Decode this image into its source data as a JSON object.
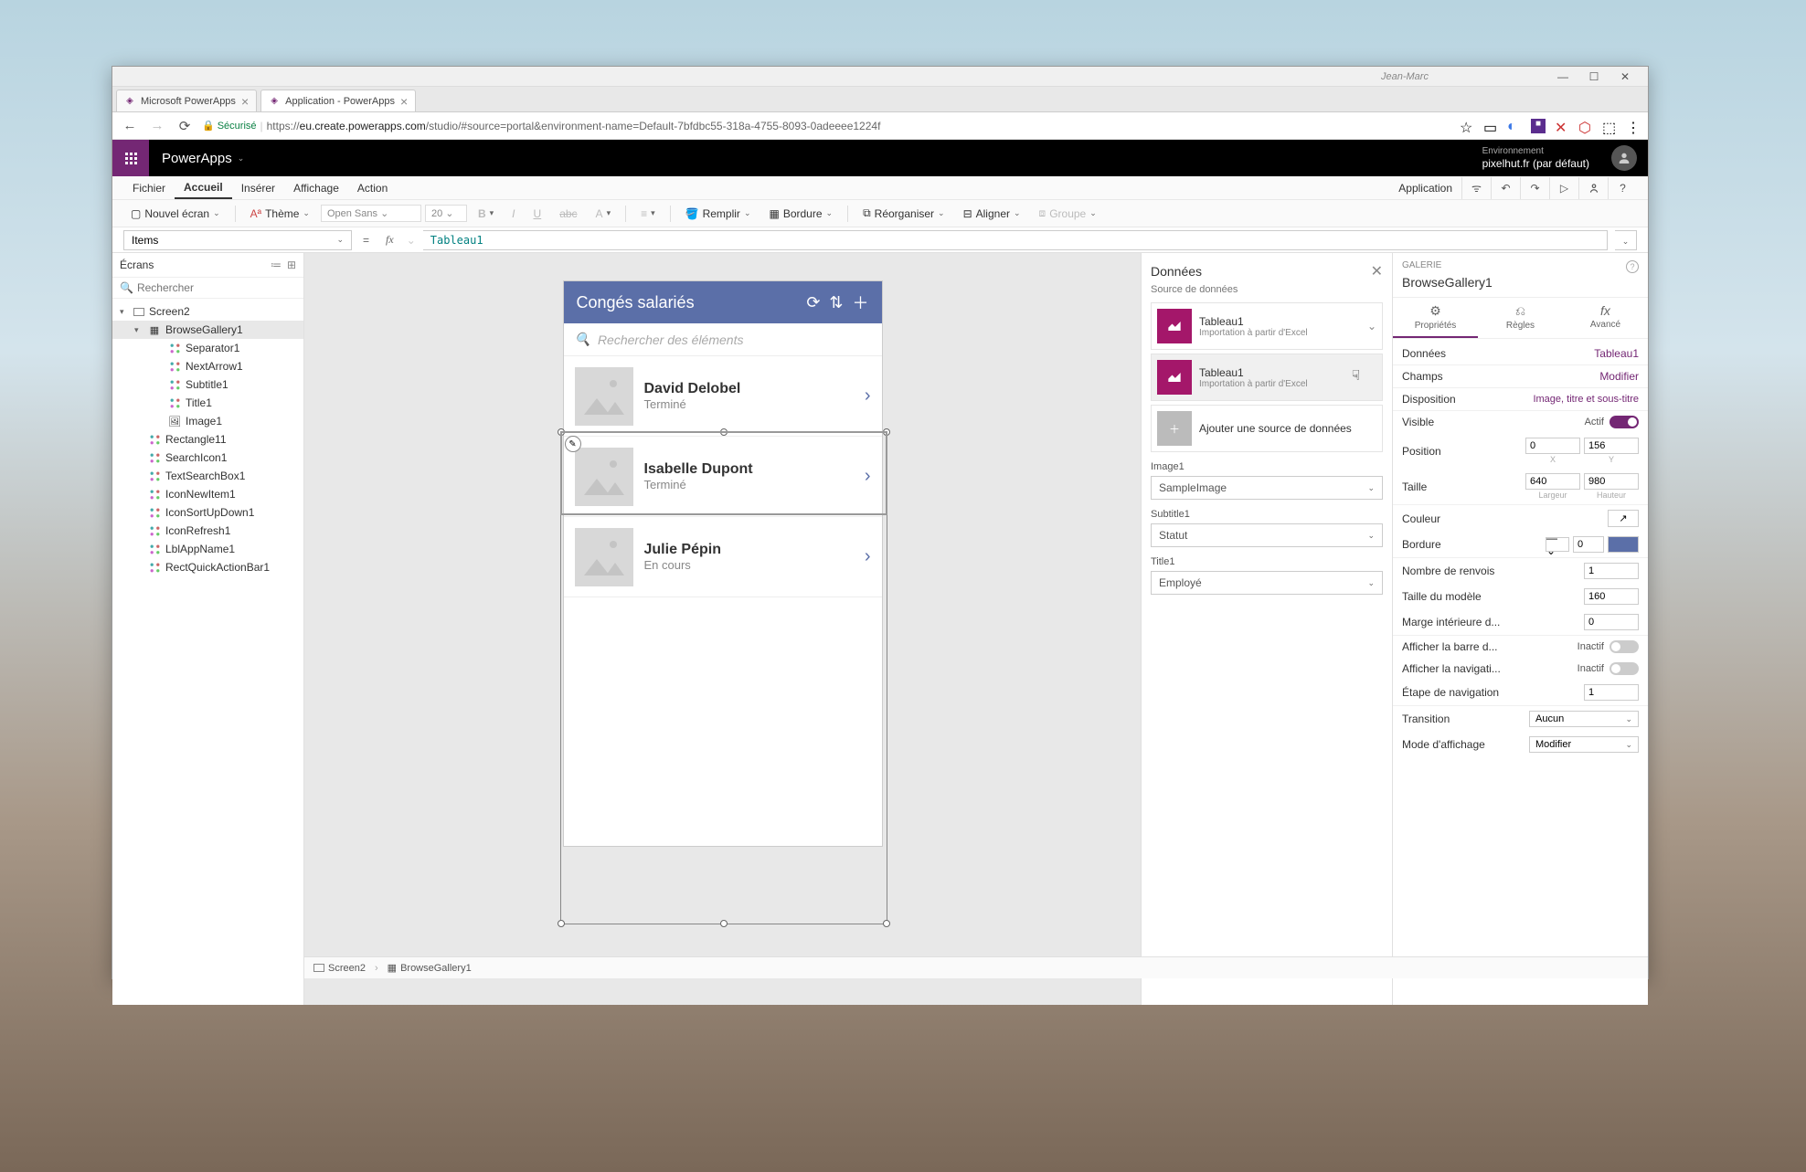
{
  "window": {
    "user": "Jean-Marc"
  },
  "tabs": [
    {
      "label": "Microsoft PowerApps"
    },
    {
      "label": "Application - PowerApps"
    }
  ],
  "address": {
    "secure": "Sécurisé",
    "url_prefix": "https://",
    "url_host": "eu.create.powerapps.com",
    "url_path": "/studio/#source=portal&environment-name=Default-7bfdbc55-318a-4755-8093-0adeeee1224f"
  },
  "app_header": {
    "name": "PowerApps",
    "env_label": "Environnement",
    "env_value": "pixelhut.fr (par défaut)"
  },
  "menu": {
    "items": [
      "Fichier",
      "Accueil",
      "Insérer",
      "Affichage",
      "Action"
    ],
    "application": "Application"
  },
  "toolbar": {
    "new_screen": "Nouvel écran",
    "theme": "Thème",
    "font": "Open Sans",
    "size": "20",
    "fill": "Remplir",
    "border": "Bordure",
    "reorganize": "Réorganiser",
    "align": "Aligner",
    "group": "Groupe"
  },
  "formula": {
    "property": "Items",
    "value": "Tableau1"
  },
  "tree": {
    "header": "Écrans",
    "search_ph": "Rechercher",
    "items": [
      {
        "label": "Screen2",
        "level": 1,
        "type": "screen",
        "caret": "▾"
      },
      {
        "label": "BrowseGallery1",
        "level": 2,
        "type": "gallery",
        "caret": "▾",
        "selected": true
      },
      {
        "label": "Separator1",
        "level": 3,
        "type": "ctrl"
      },
      {
        "label": "NextArrow1",
        "level": 3,
        "type": "ctrl"
      },
      {
        "label": "Subtitle1",
        "level": 3,
        "type": "ctrl"
      },
      {
        "label": "Title1",
        "level": 3,
        "type": "ctrl"
      },
      {
        "label": "Image1",
        "level": 3,
        "type": "img"
      },
      {
        "label": "Rectangle11",
        "level": 2,
        "type": "ctrl"
      },
      {
        "label": "SearchIcon1",
        "level": 2,
        "type": "ctrl"
      },
      {
        "label": "TextSearchBox1",
        "level": 2,
        "type": "ctrl"
      },
      {
        "label": "IconNewItem1",
        "level": 2,
        "type": "ctrl"
      },
      {
        "label": "IconSortUpDown1",
        "level": 2,
        "type": "ctrl"
      },
      {
        "label": "IconRefresh1",
        "level": 2,
        "type": "ctrl"
      },
      {
        "label": "LblAppName1",
        "level": 2,
        "type": "ctrl"
      },
      {
        "label": "RectQuickActionBar1",
        "level": 2,
        "type": "ctrl"
      }
    ]
  },
  "phone": {
    "title": "Congés salariés",
    "search_ph": "Rechercher des éléments",
    "items": [
      {
        "title": "David Delobel",
        "sub": "Terminé"
      },
      {
        "title": "Isabelle Dupont",
        "sub": "Terminé"
      },
      {
        "title": "Julie Pépin",
        "sub": "En cours"
      }
    ]
  },
  "data_panel": {
    "header": "Données",
    "source_lbl": "Source de données",
    "sources": [
      {
        "name": "Tableau1",
        "desc": "Importation à partir d'Excel"
      },
      {
        "name": "Tableau1",
        "desc": "Importation à partir d'Excel"
      }
    ],
    "add_source": "Ajouter une source de données",
    "fields": [
      {
        "label": "Image1",
        "value": "SampleImage"
      },
      {
        "label": "Subtitle1",
        "value": "Statut"
      },
      {
        "label": "Title1",
        "value": "Employé"
      }
    ]
  },
  "prop_panel": {
    "category": "GALERIE",
    "name": "BrowseGallery1",
    "tabs": {
      "props": "Propriétés",
      "rules": "Règles",
      "advanced": "Avancé"
    },
    "rows": {
      "data": {
        "label": "Données",
        "value": "Tableau1"
      },
      "fields": {
        "label": "Champs",
        "value": "Modifier"
      },
      "layout": {
        "label": "Disposition",
        "value": "Image, titre et sous-titre"
      },
      "visible": {
        "label": "Visible",
        "status": "Actif"
      },
      "position": {
        "label": "Position",
        "x": "0",
        "y": "156",
        "xl": "X",
        "yl": "Y"
      },
      "size": {
        "label": "Taille",
        "w": "640",
        "h": "980",
        "wl": "Largeur",
        "hl": "Hauteur"
      },
      "color": {
        "label": "Couleur"
      },
      "border": {
        "label": "Bordure",
        "width": "0"
      },
      "wrap": {
        "label": "Nombre de renvois",
        "value": "1"
      },
      "tmpl_size": {
        "label": "Taille du modèle",
        "value": "160"
      },
      "padding": {
        "label": "Marge intérieure d...",
        "value": "0"
      },
      "scrollbar": {
        "label": "Afficher la barre d...",
        "status": "Inactif"
      },
      "nav": {
        "label": "Afficher la navigati...",
        "status": "Inactif"
      },
      "nav_step": {
        "label": "Étape de navigation",
        "value": "1"
      },
      "transition": {
        "label": "Transition",
        "value": "Aucun"
      },
      "display": {
        "label": "Mode d'affichage",
        "value": "Modifier"
      }
    }
  },
  "breadcrumb": {
    "screen": "Screen2",
    "gallery": "BrowseGallery1"
  }
}
